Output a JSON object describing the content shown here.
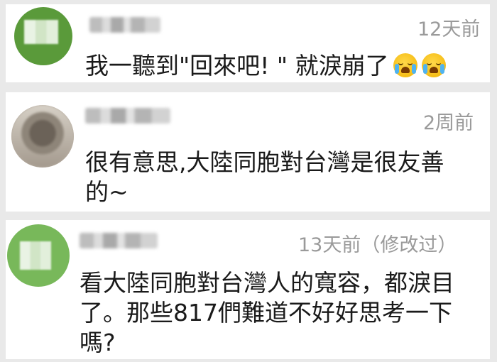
{
  "comments": [
    {
      "time": "12天前",
      "text": "我一聽到\"回來吧! \" 就淚崩了"
    },
    {
      "time": "2周前",
      "text_line1": "很有意思,大陸同胞對台灣是很友善",
      "text_line2": "的~"
    },
    {
      "time": "13天前（修改过）",
      "text_line1": "看大陸同胞對台灣人的寬容，都淚目",
      "text_line2": "了。那些817們難道不好好思考一下",
      "text_line3": "嗎?"
    }
  ],
  "icons": {
    "emoji": "crying-face-emoji"
  },
  "colors": {
    "background": "#e9e9e9",
    "card": "#ffffff",
    "timestamp": "#9a9a9a",
    "text": "#1a1a1a"
  }
}
